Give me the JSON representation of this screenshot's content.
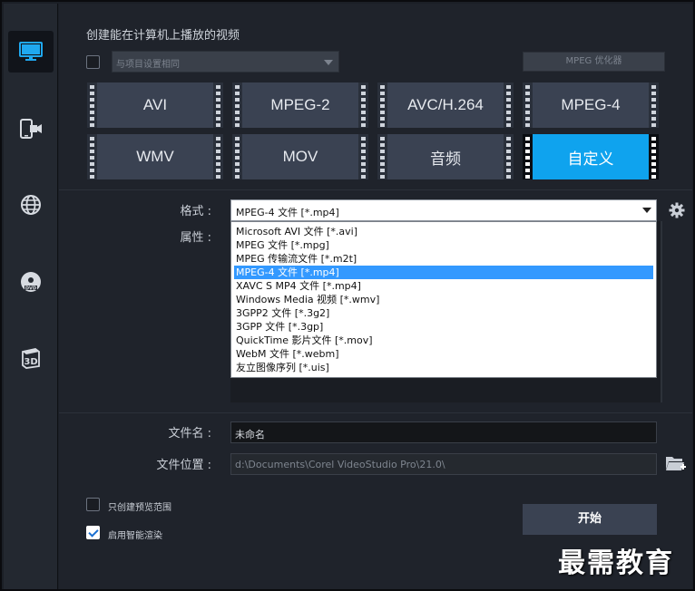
{
  "sidebar": {
    "items": [
      {
        "icon": "monitor-icon",
        "active": true
      },
      {
        "icon": "mobile-device-icon",
        "active": false
      },
      {
        "icon": "globe-icon",
        "active": false
      },
      {
        "icon": "dvd-disc-icon",
        "active": false
      },
      {
        "icon": "3d-icon",
        "active": false
      }
    ]
  },
  "header": {
    "title": "创建能在计算机上播放的视频",
    "same_as_project_label": "与项目设置相同",
    "same_as_project_checked": false,
    "mpeg_optimizer_label": "MPEG 优化器"
  },
  "formats": [
    {
      "label": "AVI",
      "selected": false
    },
    {
      "label": "MPEG-2",
      "selected": false
    },
    {
      "label": "AVC/H.264",
      "selected": false
    },
    {
      "label": "MPEG-4",
      "selected": false
    },
    {
      "label": "WMV",
      "selected": false
    },
    {
      "label": "MOV",
      "selected": false
    },
    {
      "label": "音频",
      "selected": false
    },
    {
      "label": "自定义",
      "selected": true
    }
  ],
  "settings": {
    "format_label": "格式 :",
    "format_value": "MPEG-4 文件 [*.mp4]",
    "properties_label": "属性 :",
    "format_options": [
      "Microsoft AVI 文件 [*.avi]",
      "MPEG 文件 [*.mpg]",
      "MPEG 传输流文件 [*.m2t]",
      "MPEG-4 文件 [*.mp4]",
      "XAVC S MP4 文件 [*.mp4]",
      "Windows Media 视频 [*.wmv]",
      "3GPP2 文件 [*.3g2]",
      "3GPP 文件 [*.3gp]",
      "QuickTime 影片文件 [*.mov]",
      "WebM 文件 [*.webm]",
      "友立图像序列 [*.uis]"
    ],
    "format_selected_index": 3
  },
  "output": {
    "filename_label": "文件名 :",
    "filename_value": "未命名",
    "location_label": "文件位置 :",
    "location_value": "d:\\Documents\\Corel VideoStudio Pro\\21.0\\"
  },
  "options": {
    "preview_range_label": "只创建预览范围",
    "preview_range_checked": false,
    "smart_render_label": "启用智能渲染",
    "smart_render_checked": true
  },
  "actions": {
    "start_label": "开始"
  },
  "watermark": "最需教育",
  "colors": {
    "accent": "#0fa3ee",
    "panel": "#1f232b",
    "button": "#3a4252"
  }
}
